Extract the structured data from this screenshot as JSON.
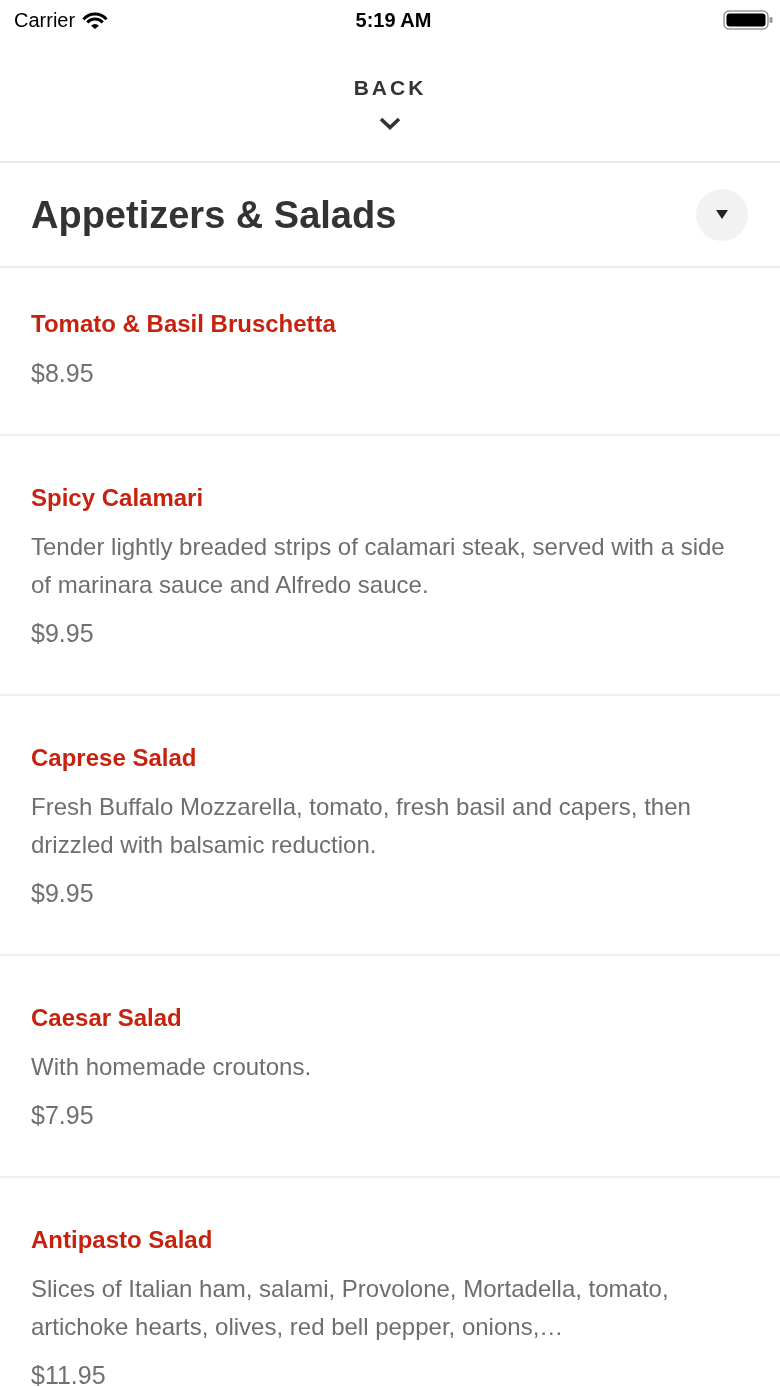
{
  "status_bar": {
    "carrier": "Carrier",
    "time": "5:19 AM"
  },
  "header": {
    "back_label": "BACK"
  },
  "category": {
    "title": "Appetizers & Salads"
  },
  "items": [
    {
      "name": "Tomato & Basil Bruschetta",
      "price": "$8.95"
    },
    {
      "name": "Spicy Calamari",
      "description": "Tender lightly breaded strips of calamari steak, served with a side of marinara sauce and Alfredo sauce.",
      "price": "$9.95"
    },
    {
      "name": "Caprese Salad",
      "description": "Fresh Buffalo Mozzarella, tomato, fresh basil and capers, then drizzled with balsamic reduction.",
      "price": "$9.95"
    },
    {
      "name": "Caesar Salad",
      "description": "With homemade croutons.",
      "price": "$7.95"
    },
    {
      "name": "Antipasto Salad",
      "description": "Slices of Italian ham, salami, Provolone, Mortadella, tomato, artichoke hearts, olives, red bell pepper, onions,…",
      "price": "$11.95"
    }
  ]
}
